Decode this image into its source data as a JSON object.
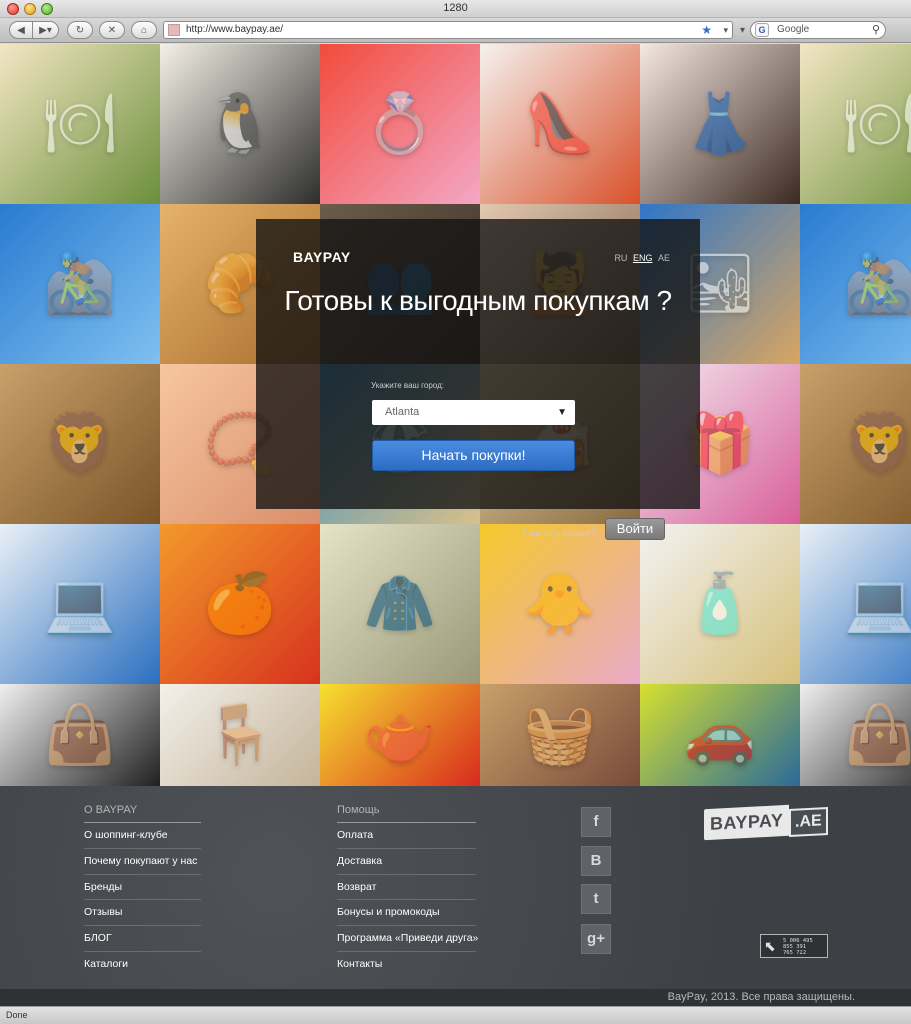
{
  "window": {
    "title": "1280"
  },
  "browser": {
    "url": "http://www.baypay.ae/",
    "search_placeholder": "Google",
    "status": "Done"
  },
  "overlay": {
    "brand": "BAYPAY",
    "languages": [
      "RU",
      "ENG",
      "AE"
    ],
    "active_language": "ENG",
    "headline": "Готовы к выгодным покупкам ?",
    "city_label": "Укажите ваш город:",
    "city_value": "Atlanta",
    "start_button": "Начать покупки!",
    "account_question": "У вас есть аккаунт?",
    "login_button": "Войти"
  },
  "footer": {
    "col1": {
      "heading": "О BAYPAY",
      "items": [
        "О шоппинг-клубе",
        "Почему покупают у нас",
        "Бренды",
        "Отзывы",
        "БЛОГ",
        "Каталоги"
      ]
    },
    "col2": {
      "heading": "Помощь",
      "items": [
        "Оплата",
        "Доставка",
        "Возврат",
        "Бонусы и промокоды",
        "Программа «Приведи друга»",
        "Контакты"
      ]
    },
    "social": [
      {
        "icon": "facebook-icon",
        "glyph": "f"
      },
      {
        "icon": "vkontakte-icon",
        "glyph": "B"
      },
      {
        "icon": "twitter-icon",
        "glyph": "t"
      },
      {
        "icon": "google-plus-icon",
        "glyph": "g+"
      }
    ],
    "logo": {
      "main": "BAYPAY",
      "suffix": ".AE"
    },
    "badge_lines": [
      "5 006 495",
      "855 391",
      "765 722"
    ],
    "copyright": "BayPay, 2013. Все права защищены."
  },
  "mosaic": {
    "tiles": [
      {
        "name": "tile-food-plate",
        "icon": "🍽",
        "colors": [
          "#f3e6c4",
          "#6b8f3a"
        ]
      },
      {
        "name": "tile-penguins",
        "icon": "🐧",
        "colors": [
          "#f4f0e6",
          "#2e2e2e"
        ]
      },
      {
        "name": "tile-heart-ring",
        "icon": "💍",
        "colors": [
          "#f24b3b",
          "#f3a7c6"
        ]
      },
      {
        "name": "tile-shoe",
        "icon": "👠",
        "colors": [
          "#f6f1ee",
          "#d8512a"
        ]
      },
      {
        "name": "tile-dress",
        "icon": "👗",
        "colors": [
          "#f5e8e1",
          "#3b2a22"
        ]
      },
      {
        "name": "tile-food-plate-repeat",
        "icon": "🍽",
        "colors": [
          "#f3e6c4",
          "#6b8f3a"
        ]
      },
      {
        "name": "tile-cyclist",
        "icon": "🚵",
        "colors": [
          "#2a7bd0",
          "#7fc0f0"
        ]
      },
      {
        "name": "tile-pastries",
        "icon": "🥐",
        "colors": [
          "#e6b36b",
          "#a86d2c"
        ]
      },
      {
        "name": "tile-friends",
        "icon": "👥",
        "colors": [
          "#6b5b4a",
          "#3a2e25"
        ]
      },
      {
        "name": "tile-spa",
        "icon": "💆",
        "colors": [
          "#e3c8b0",
          "#7a5f4a"
        ]
      },
      {
        "name": "tile-pyramids",
        "icon": "🏜",
        "colors": [
          "#2f76c9",
          "#d8a560"
        ]
      },
      {
        "name": "tile-cyclist-repeat",
        "icon": "🚵",
        "colors": [
          "#2a7bd0",
          "#7fc0f0"
        ]
      },
      {
        "name": "tile-lion",
        "icon": "🦁",
        "colors": [
          "#c9a06a",
          "#7a5428"
        ]
      },
      {
        "name": "tile-pearls",
        "icon": "📿",
        "colors": [
          "#f6c6a0",
          "#d98e6a"
        ]
      },
      {
        "name": "tile-beach",
        "icon": "🏖",
        "colors": [
          "#3c8fbf",
          "#d9c08a"
        ]
      },
      {
        "name": "tile-dessert",
        "icon": "🍰",
        "colors": [
          "#e0cfa0",
          "#8a6a40"
        ]
      },
      {
        "name": "tile-gifts",
        "icon": "🎁",
        "colors": [
          "#f3eaf0",
          "#d85f9a"
        ]
      },
      {
        "name": "tile-lion-repeat",
        "icon": "🦁",
        "colors": [
          "#c9a06a",
          "#7a5428"
        ]
      },
      {
        "name": "tile-laptop",
        "icon": "💻",
        "colors": [
          "#eaf0f6",
          "#2a6fc0"
        ]
      },
      {
        "name": "tile-fruits",
        "icon": "🍊",
        "colors": [
          "#f29a2a",
          "#d8321e"
        ]
      },
      {
        "name": "tile-suit",
        "icon": "🧥",
        "colors": [
          "#e5e3c8",
          "#9a9878"
        ]
      },
      {
        "name": "tile-toys",
        "icon": "🐥",
        "colors": [
          "#f4c92a",
          "#e9a9c8"
        ]
      },
      {
        "name": "tile-perfume",
        "icon": "🧴",
        "colors": [
          "#f2f2f2",
          "#d6c07a"
        ]
      },
      {
        "name": "tile-laptop-repeat",
        "icon": "💻",
        "colors": [
          "#eaf0f6",
          "#2a6fc0"
        ]
      },
      {
        "name": "tile-bag",
        "icon": "👜",
        "colors": [
          "#f0f0f0",
          "#202020"
        ]
      },
      {
        "name": "tile-terrace",
        "icon": "🪑",
        "colors": [
          "#f3f0ea",
          "#c4b49a"
        ]
      },
      {
        "name": "tile-dishes",
        "icon": "🫖",
        "colors": [
          "#f6e030",
          "#d82a1e"
        ]
      },
      {
        "name": "tile-textiles",
        "icon": "🧺",
        "colors": [
          "#c8a06a",
          "#7a4a3a"
        ]
      },
      {
        "name": "tile-car",
        "icon": "🚗",
        "colors": [
          "#d6e030",
          "#2a6a9a"
        ]
      },
      {
        "name": "tile-bag-repeat",
        "icon": "👜",
        "colors": [
          "#f0f0f0",
          "#202020"
        ]
      }
    ]
  }
}
